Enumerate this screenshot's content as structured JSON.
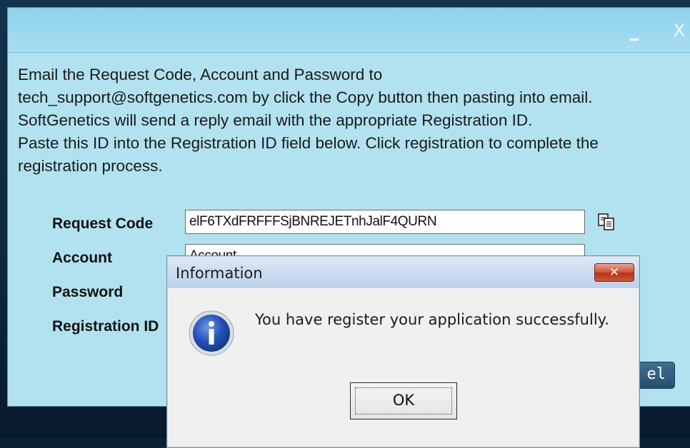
{
  "registration_window": {
    "close_glyph": "X",
    "minimize_glyph": "_",
    "instructions": [
      "Email the Request Code, Account and Password to",
      "tech_support@softgenetics.com by click the Copy button then pasting into email.",
      "SoftGenetics will send a reply email with the appropriate Registration ID.",
      "Paste this ID into the Registration ID field below. Click registration to complete the",
      "registration process."
    ],
    "fields": {
      "request_code_label": "Request Code",
      "request_code_value": "elF6TXdFRFFFSjBNREJETnhJalF4QURN",
      "account_label": "Account",
      "account_value": "Account",
      "password_label": "Password",
      "registration_id_label": "Registration ID"
    },
    "cancel_button_visible_text": "el",
    "copy_icon": "copy-icon"
  },
  "info_dialog": {
    "title": "Information",
    "close_glyph": "✕",
    "message": "You have register your application successfully.",
    "ok_label": "OK",
    "icon": "info-icon"
  },
  "colors": {
    "window_bg": "#b2e2ef",
    "titlebar": "#9ad8f0",
    "dialog_bg": "#f0f0f0",
    "dialog_close": "#c9583a",
    "info_icon_blue": "#2350b8"
  }
}
